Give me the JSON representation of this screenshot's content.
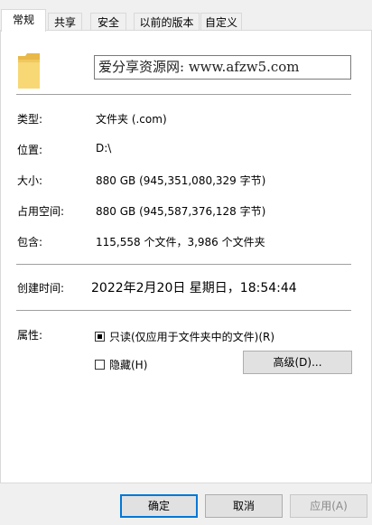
{
  "tabs": [
    {
      "label": "常规",
      "active": true
    },
    {
      "label": "共享",
      "active": false
    },
    {
      "label": "安全",
      "active": false
    },
    {
      "label": "以前的版本",
      "active": false
    },
    {
      "label": "自定义",
      "active": false
    }
  ],
  "name_field": {
    "value": "爱分享资源网: www.afzw5.com"
  },
  "properties": {
    "type_label": "类型:",
    "type_value": "文件夹 (.com)",
    "location_label": "位置:",
    "location_value": "D:\\",
    "size_label": "大小:",
    "size_value": "880 GB (945,351,080,329 字节)",
    "disk_size_label": "占用空间:",
    "disk_size_value": "880 GB (945,587,376,128 字节)",
    "contains_label": "包含:",
    "contains_value": "115,558 个文件，3,986 个文件夹",
    "created_label": "创建时间:",
    "created_value": "2022年2月20日 星期日，18:54:44"
  },
  "attributes": {
    "label": "属性:",
    "readonly_label": "只读(仅应用于文件夹中的文件)(R)",
    "readonly_state": "indeterminate",
    "hidden_label": "隐藏(H)",
    "hidden_checked": false,
    "advanced_button": "高级(D)..."
  },
  "footer": {
    "ok": "确定",
    "cancel": "取消",
    "apply": "应用(A)"
  },
  "colors": {
    "accent": "#0078d7",
    "folder": "#f8d775"
  }
}
